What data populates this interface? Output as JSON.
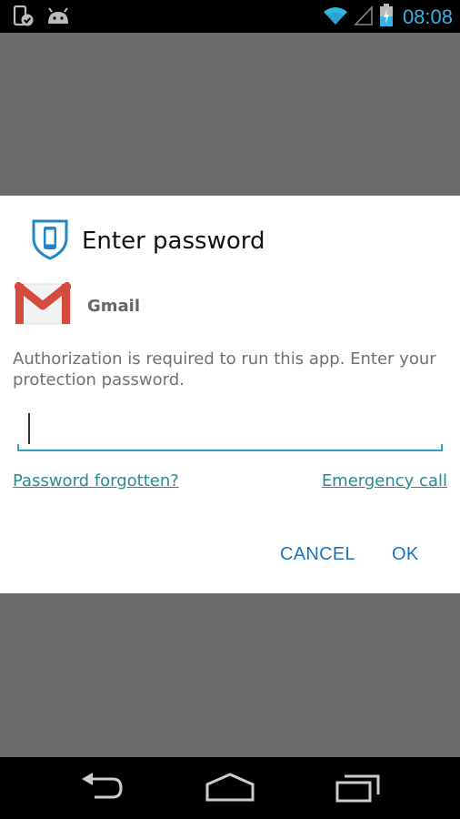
{
  "status_bar": {
    "time": "08:08",
    "icons": [
      "phone-check-icon",
      "android-icon",
      "wifi-icon",
      "signal-icon",
      "battery-charging-icon"
    ]
  },
  "dialog": {
    "title": "Enter password",
    "header_icon": "shield-phone-icon",
    "app": {
      "name": "Gmail",
      "icon": "gmail-icon"
    },
    "message": "Authorization is required to run this app. Enter your protection password.",
    "password": {
      "value": "",
      "placeholder": ""
    },
    "links": {
      "forgot": "Password forgotten?",
      "emergency": "Emergency call"
    },
    "buttons": {
      "cancel": "CANCEL",
      "ok": "OK"
    },
    "colors": {
      "accent": "#33a0c7",
      "link": "#2a8a8f",
      "button": "#1f74b9"
    }
  },
  "nav_bar": {
    "icons": [
      "back-icon",
      "home-icon",
      "recents-icon"
    ]
  }
}
